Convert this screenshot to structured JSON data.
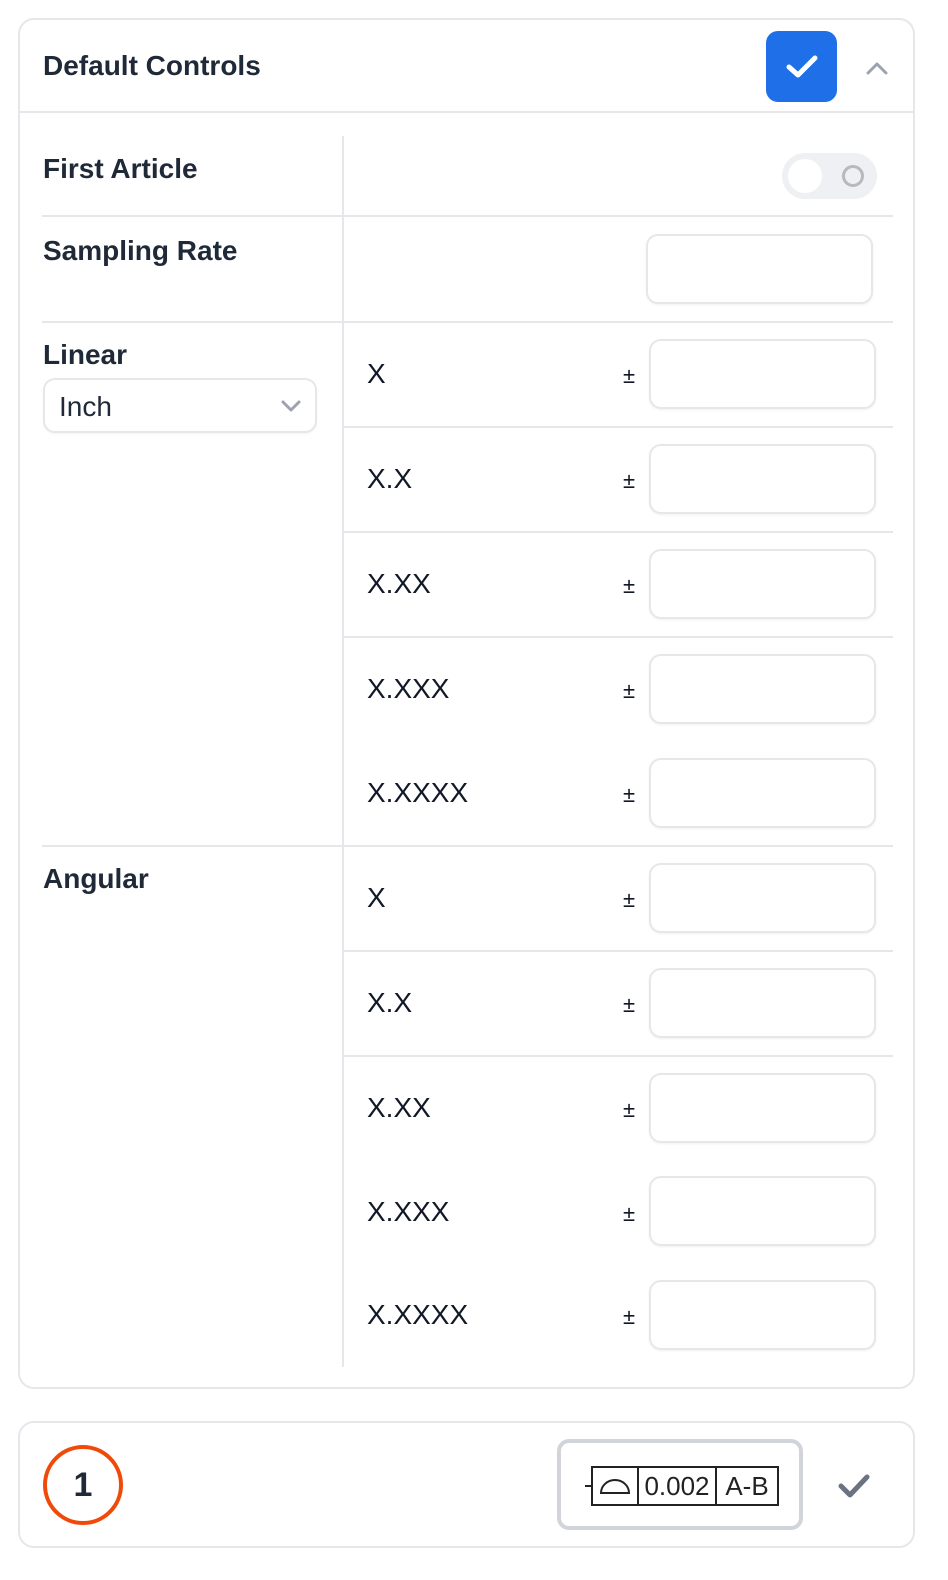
{
  "default_controls": {
    "title": "Default Controls",
    "enabled": true,
    "collapse_icon": "chevron-up-icon"
  },
  "first_article": {
    "label": "First Article",
    "toggle_on": false
  },
  "sampling_rate": {
    "label": "Sampling Rate",
    "value": ""
  },
  "linear": {
    "label": "Linear",
    "unit": "Inch",
    "plus_minus": "±",
    "rows": [
      {
        "format": "X",
        "tolerance": ""
      },
      {
        "format": "X.X",
        "tolerance": ""
      },
      {
        "format": "X.XX",
        "tolerance": ""
      },
      {
        "format": "X.XXX",
        "tolerance": ""
      },
      {
        "format": "X.XXXX",
        "tolerance": ""
      }
    ]
  },
  "angular": {
    "label": "Angular",
    "plus_minus": "±",
    "rows": [
      {
        "format": "X",
        "tolerance": ""
      },
      {
        "format": "X.X",
        "tolerance": ""
      },
      {
        "format": "X.XX",
        "tolerance": ""
      },
      {
        "format": "X.XXX",
        "tolerance": ""
      },
      {
        "format": "X.XXXX",
        "tolerance": ""
      }
    ]
  },
  "feature": {
    "number": "1",
    "symbol": "profile-of-surface-icon",
    "tolerance": "0.002",
    "datum": "A-B",
    "confirmed_icon": "check-icon"
  },
  "colors": {
    "accent": "#1f6fe8",
    "badge_ring": "#f04a0a",
    "border": "#e5e7eb"
  }
}
